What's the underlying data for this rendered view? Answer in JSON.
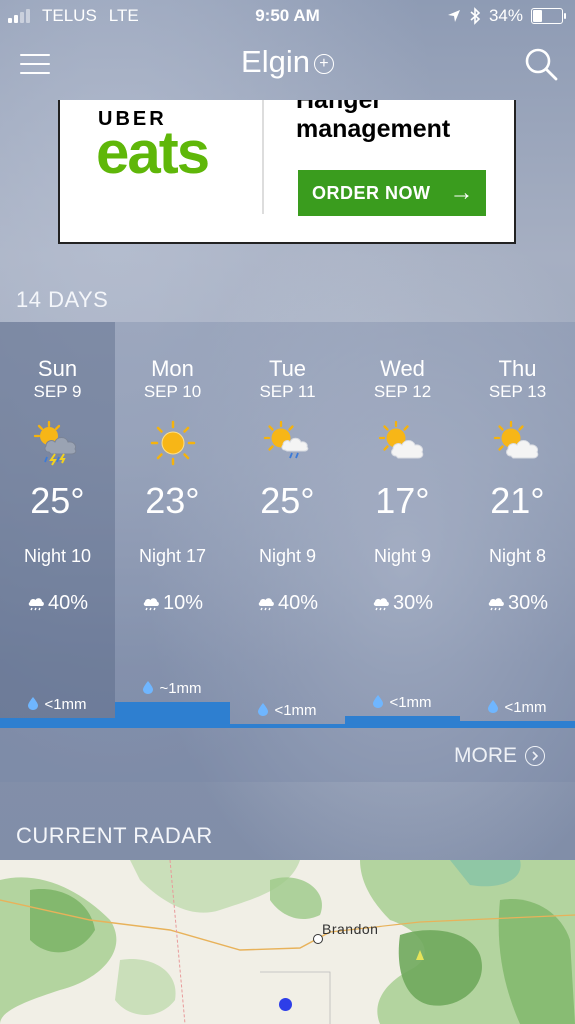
{
  "status_bar": {
    "carrier": "TELUS",
    "network": "LTE",
    "time": "9:50 AM",
    "battery": "34%",
    "battery_level": 0.34
  },
  "header": {
    "city": "Elgin",
    "add_icon": "plus-circle-icon",
    "menu_icon": "hamburger-menu-icon",
    "search_icon": "search-icon"
  },
  "ad": {
    "brand_top": "UBER",
    "brand_bottom": "eats",
    "headline_line1": "Hanger",
    "headline_line2": "management",
    "cta": "ORDER NOW",
    "cta_arrow": "→",
    "brand_color": "#5fb709",
    "cta_color": "#3a9c1e"
  },
  "forecast": {
    "title": "14 DAYS",
    "days": [
      {
        "day": "Sun",
        "date": "SEP 9",
        "icon": "sun-thunderstorm-icon",
        "temp": "25°",
        "night": "Night 10",
        "precip": "40%",
        "rain": "<1mm",
        "rain_level": 0.4
      },
      {
        "day": "Mon",
        "date": "SEP 10",
        "icon": "sunny-icon",
        "temp": "23°",
        "night": "Night 17",
        "precip": "10%",
        "rain": "~1mm",
        "rain_level": 1.0
      },
      {
        "day": "Tue",
        "date": "SEP 11",
        "icon": "sun-cloud-rain-icon",
        "temp": "25°",
        "night": "Night 9",
        "precip": "40%",
        "rain": "<1mm",
        "rain_level": 0.15
      },
      {
        "day": "Wed",
        "date": "SEP 12",
        "icon": "partly-cloudy-icon",
        "temp": "17°",
        "night": "Night 9",
        "precip": "30%",
        "rain": "<1mm",
        "rain_level": 0.45
      },
      {
        "day": "Thu",
        "date": "SEP 13",
        "icon": "partly-cloudy-icon",
        "temp": "21°",
        "night": "Night 8",
        "precip": "30%",
        "rain": "<1mm",
        "rain_level": 0.25
      }
    ],
    "more": "MORE"
  },
  "radar": {
    "title": "CURRENT RADAR",
    "city_label": "Brandon"
  },
  "colors": {
    "rain_bar": "#2e7fd0",
    "radar_green": "#8fc27a",
    "location_dot": "#2e3ee8"
  }
}
